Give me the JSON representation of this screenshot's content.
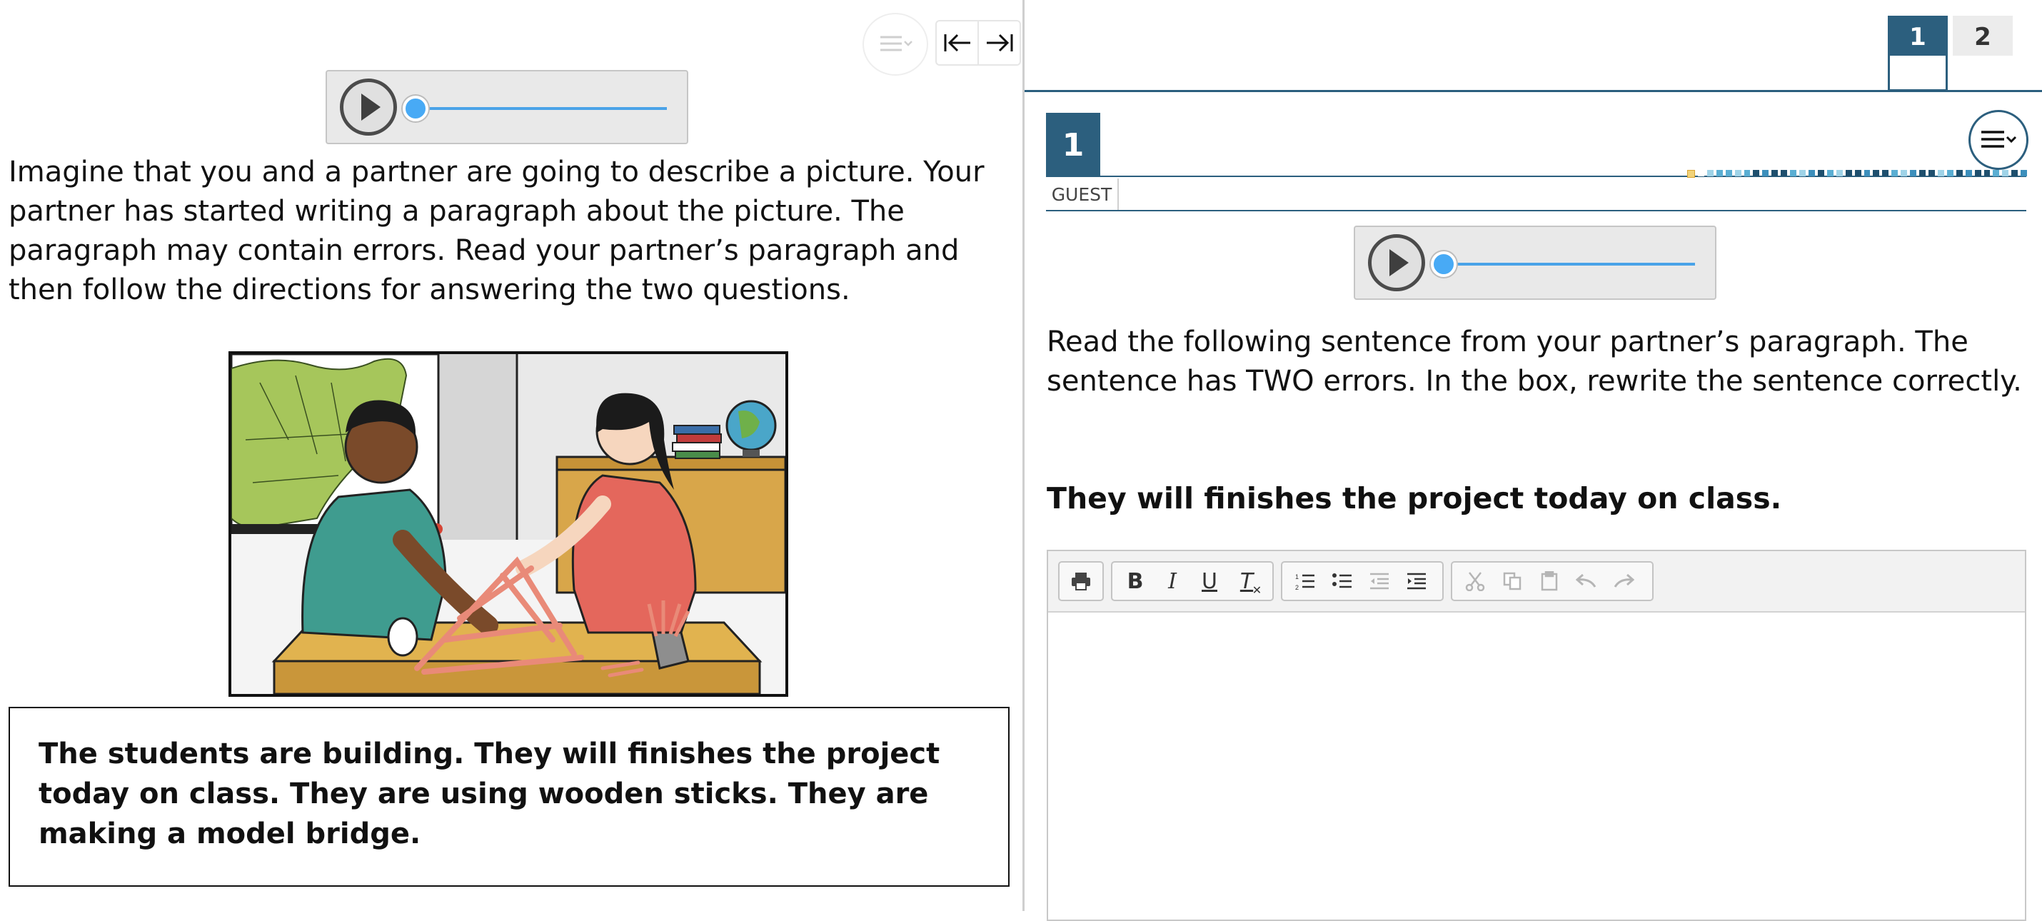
{
  "left": {
    "intro": "Imagine that you and a partner are going to describe a picture. Your partner has started writing a paragraph about the picture. The paragraph may contain errors. Read your partner’s paragraph and then follow the directions for answering the two questions.",
    "partner_paragraph": "The students are building. They will finishes the project today on class. They are using wooden sticks. They are making a model bridge."
  },
  "right": {
    "tabs": [
      {
        "label": "1"
      },
      {
        "label": "2"
      }
    ],
    "question_number": "1",
    "user_label": "GUEST",
    "prompt": "Read the following sentence from your partner’s paragraph. The sentence has TWO errors. In the box, rewrite the sentence correctly.",
    "sentence": "They will finishes the project today on class.",
    "progress_colors": [
      "#f1d37a",
      "#ffffff",
      "#9fd3e8",
      "#5aaed3",
      "#1e4f6e",
      "#3c8fbc",
      "#1e4f6e"
    ]
  },
  "editor": {
    "toolbar": [
      {
        "group": "print",
        "items": [
          "print-icon"
        ]
      },
      {
        "group": "format",
        "items": [
          "bold",
          "italic",
          "underline",
          "clear-format"
        ]
      },
      {
        "group": "list",
        "items": [
          "numbered-list",
          "bulleted-list",
          "outdent",
          "indent"
        ]
      },
      {
        "group": "edit",
        "items": [
          "cut",
          "copy",
          "paste",
          "undo",
          "redo"
        ]
      }
    ],
    "labels": {
      "bold": "B",
      "italic": "I",
      "underline": "U",
      "clear": "T"
    }
  },
  "colors": {
    "accent": "#2c5f7e",
    "player_knob": "#48aaf5"
  }
}
